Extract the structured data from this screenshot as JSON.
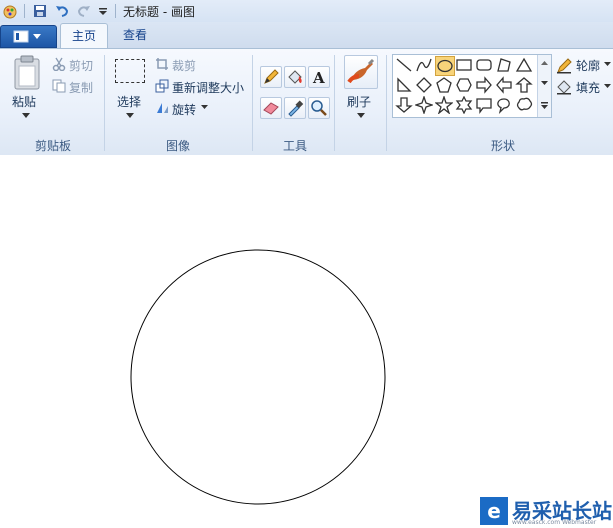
{
  "window": {
    "title": "无标题 - 画图"
  },
  "tabs": [
    {
      "label": "主页"
    },
    {
      "label": "查看"
    }
  ],
  "clipboard": {
    "paste_label": "粘贴",
    "cut_label": "剪切",
    "copy_label": "复制",
    "group_label": "剪贴板"
  },
  "image": {
    "select_label": "选择",
    "crop_label": "裁剪",
    "resize_label": "重新调整大小",
    "rotate_label": "旋转",
    "group_label": "图像"
  },
  "tools": {
    "group_label": "工具"
  },
  "brushes": {
    "label": "刷子"
  },
  "shapes": {
    "group_label": "形状",
    "outline_label": "轮廓",
    "fill_label": "填充"
  },
  "canvas": {
    "drawn_shape": "circle"
  },
  "watermark": {
    "text": "易采站长站",
    "sub": "www.easck.com  Webmaster"
  },
  "colors": {
    "accent": "#1d56a6",
    "ribbon": "#e9f0fa"
  }
}
